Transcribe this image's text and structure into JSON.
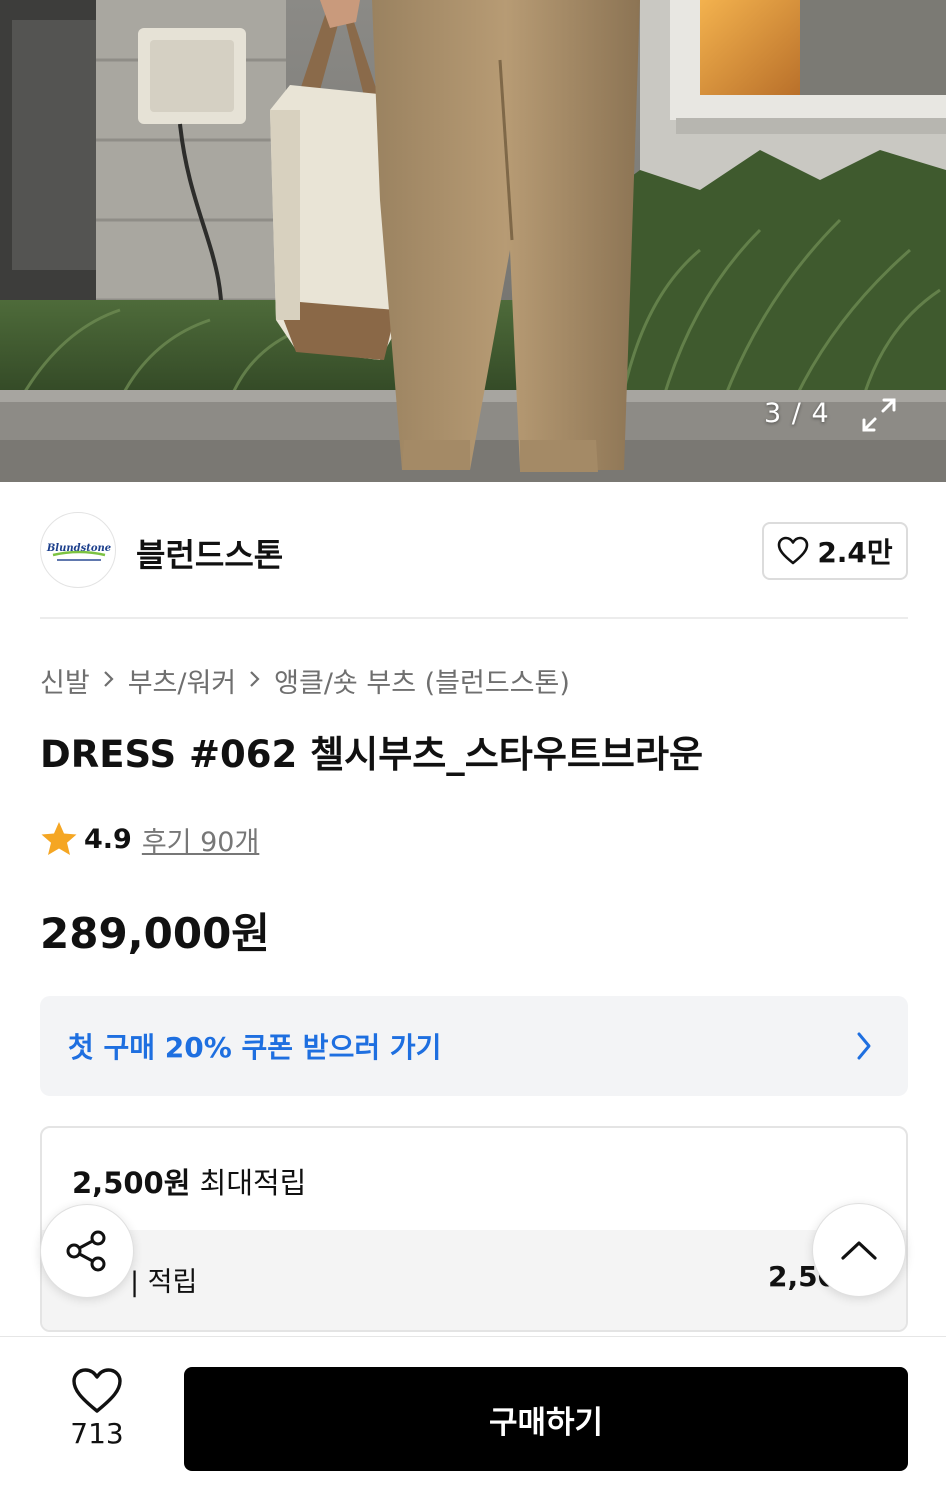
{
  "gallery": {
    "counter": "3 / 4",
    "expand_icon": "expand-icon"
  },
  "brand": {
    "logo_text": "Blundstone",
    "name": "블런드스톤",
    "like_count": "2.4만",
    "like_icon": "heart-outline-icon"
  },
  "breadcrumb": [
    "신발",
    "부츠/워커",
    "앵클/숏 부츠 (블런드스톤)"
  ],
  "product": {
    "title": "DRESS #062 첼시부츠_스타우트브라운",
    "rating": "4.9",
    "reviews": "후기 90개",
    "price": "289,000원"
  },
  "coupon": {
    "text": "첫 구매 20% 쿠폰 받으러 가기",
    "accent_color": "#1e6fe0"
  },
  "points": {
    "max_amount": "2,500원",
    "max_label": "최대적립",
    "row_label": "| 적립",
    "row_value": "2,50"
  },
  "floating": {
    "share_icon": "share-icon",
    "top_icon": "chevron-up-icon"
  },
  "bottom_bar": {
    "wish_count": "713",
    "buy_label": "구매하기"
  },
  "colors": {
    "star": "#f5a623",
    "buy_button": "#000000"
  }
}
